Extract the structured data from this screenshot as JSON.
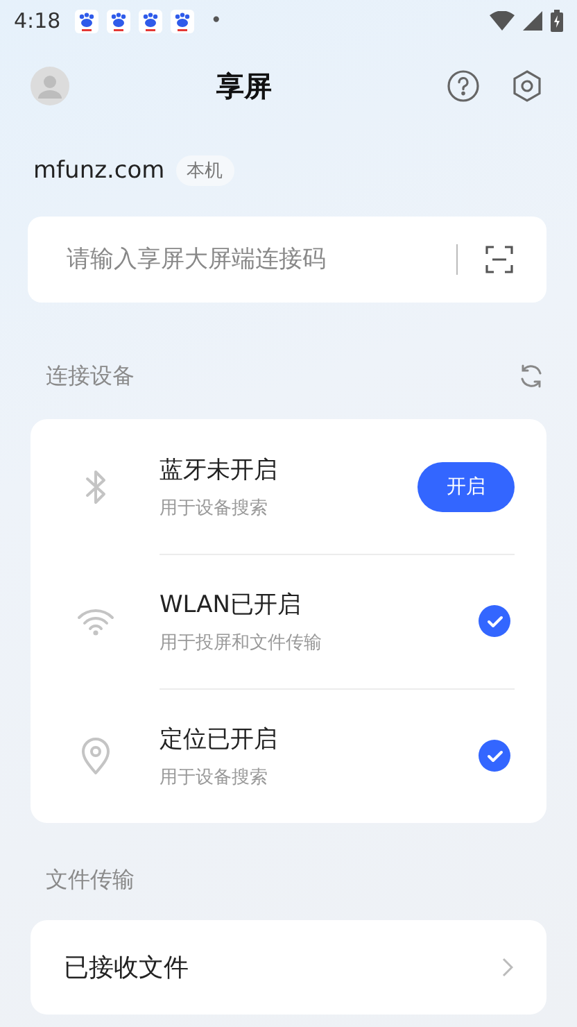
{
  "status_bar": {
    "time": "4:18",
    "notifications": [
      {
        "kind": "app"
      },
      {
        "kind": "app"
      },
      {
        "kind": "app"
      },
      {
        "kind": "app"
      }
    ],
    "dot": "•"
  },
  "header": {
    "title": "享屏"
  },
  "device": {
    "name": "mfunz.com",
    "badge": "本机"
  },
  "connect": {
    "placeholder": "请输入享屏大屏端连接码"
  },
  "devices_section": {
    "title": "连接设备"
  },
  "devices": [
    {
      "kind": "bluetooth",
      "title": "蓝牙未开启",
      "subtitle": "用于设备搜索",
      "enabled": false,
      "action": "开启"
    },
    {
      "kind": "wifi",
      "title": "WLAN已开启",
      "subtitle": "用于投屏和文件传输",
      "enabled": true
    },
    {
      "kind": "location",
      "title": "定位已开启",
      "subtitle": "用于设备搜索",
      "enabled": true
    }
  ],
  "files_section": {
    "title": "文件传输"
  },
  "files": [
    {
      "label": "已接收文件"
    }
  ]
}
